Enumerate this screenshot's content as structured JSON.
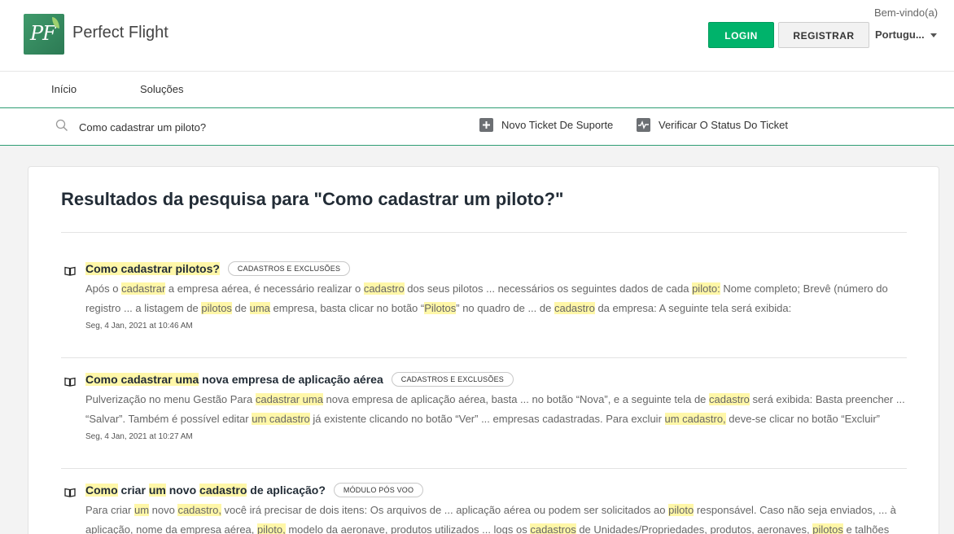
{
  "header": {
    "logo_text": "PF",
    "brand": "Perfect Flight",
    "welcome": "Bem-vindo(a)",
    "login_label": "LOGIN",
    "register_label": "REGISTRAR",
    "language": "Portugu..."
  },
  "nav": {
    "items": [
      "Início",
      "Soluções"
    ]
  },
  "search": {
    "value": "Como cadastrar um piloto?",
    "new_ticket": "Novo Ticket De Suporte",
    "check_status": "Verificar O Status Do Ticket"
  },
  "results": {
    "title": "Resultados da pesquisa para \"Como cadastrar um piloto?\"",
    "items": [
      {
        "title": [
          {
            "t": "Como cadastrar pilotos?",
            "h": true
          }
        ],
        "tag": "Cadastros e exclusões",
        "snippet": [
          {
            "t": "Após o "
          },
          {
            "t": "cadastrar",
            "h": true
          },
          {
            "t": " a empresa aérea, é necessário realizar o "
          },
          {
            "t": "cadastro",
            "h": true
          },
          {
            "t": " dos seus pilotos ... necessários os seguintes dados de cada "
          },
          {
            "t": "piloto:",
            "h": true
          },
          {
            "t": " Nome completo; Brevê (número do registro ... a listagem de "
          },
          {
            "t": "pilotos",
            "h": true
          },
          {
            "t": " de "
          },
          {
            "t": "uma",
            "h": true
          },
          {
            "t": " empresa, basta clicar no botão “"
          },
          {
            "t": "Pilotos",
            "h": true
          },
          {
            "t": "” no quadro de ... de "
          },
          {
            "t": "cadastro",
            "h": true
          },
          {
            "t": " da empresa:           A seguinte tela será exibida:"
          }
        ],
        "date": "Seg, 4 Jan, 2021 at 10:46 AM"
      },
      {
        "title": [
          {
            "t": "Como cadastrar uma",
            "h": true
          },
          {
            "t": " nova empresa de aplicação aérea"
          }
        ],
        "tag": "Cadastros e exclusões",
        "snippet": [
          {
            "t": "Pulverização no menu Gestão Para "
          },
          {
            "t": "cadastrar uma",
            "h": true
          },
          {
            "t": " nova empresa de aplicação aérea, basta ... no botão “Nova”, e a seguinte tela de "
          },
          {
            "t": "cadastro",
            "h": true
          },
          {
            "t": " será exibida:      Basta preencher ... “Salvar”. Também é possível editar "
          },
          {
            "t": "um cadastro",
            "h": true
          },
          {
            "t": " já existente clicando no botão “Ver” ... empresas cadastradas.   Para excluir "
          },
          {
            "t": "um cadastro,",
            "h": true
          },
          {
            "t": " deve-se clicar no botão “Excluir”"
          }
        ],
        "date": "Seg, 4 Jan, 2021 at 10:27 AM"
      },
      {
        "title": [
          {
            "t": "Como",
            "h": true
          },
          {
            "t": " criar "
          },
          {
            "t": "um",
            "h": true
          },
          {
            "t": " novo "
          },
          {
            "t": "cadastro",
            "h": true
          },
          {
            "t": " de aplicação?"
          }
        ],
        "tag": "Módulo pós voo",
        "snippet": [
          {
            "t": "Para criar "
          },
          {
            "t": "um",
            "h": true
          },
          {
            "t": " novo "
          },
          {
            "t": "cadastro,",
            "h": true
          },
          {
            "t": " você irá precisar de dois itens:  Os arquivos de ... aplicação aérea ou podem ser solicitados ao "
          },
          {
            "t": "piloto",
            "h": true
          },
          {
            "t": " responsável. Caso não seja enviados, ... à aplicação, nome da empresa aérea, "
          },
          {
            "t": "piloto,",
            "h": true
          },
          {
            "t": " modelo da aeronave, produtos utilizados ... logs os "
          },
          {
            "t": "cadastros",
            "h": true
          },
          {
            "t": " de Unidades/Propriedades, produtos, aeronaves, "
          },
          {
            "t": "pilotos",
            "h": true
          },
          {
            "t": " e talhões"
          }
        ],
        "date": ""
      }
    ]
  }
}
